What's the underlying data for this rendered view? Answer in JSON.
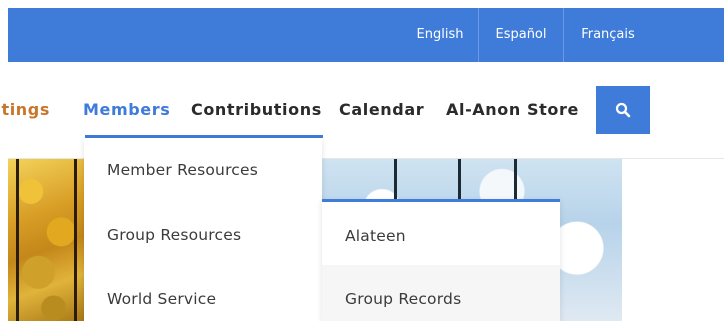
{
  "languages": {
    "english": "English",
    "espanol": "Español",
    "francais": "Français"
  },
  "nav": {
    "meetings": "etings",
    "members": "Members",
    "contributions": "Contributions",
    "calendar": "Calendar",
    "store": "Al-Anon Store",
    "search_icon": "search-icon"
  },
  "members_menu": {
    "items": [
      "Member Resources",
      "Group Resources",
      "World Service"
    ]
  },
  "sub_menu": {
    "items": [
      "Alateen",
      "Group Records"
    ]
  },
  "colors": {
    "accent": "#3f7bd9",
    "meetings_orange": "#c8762b",
    "text": "#2b2b2b"
  }
}
